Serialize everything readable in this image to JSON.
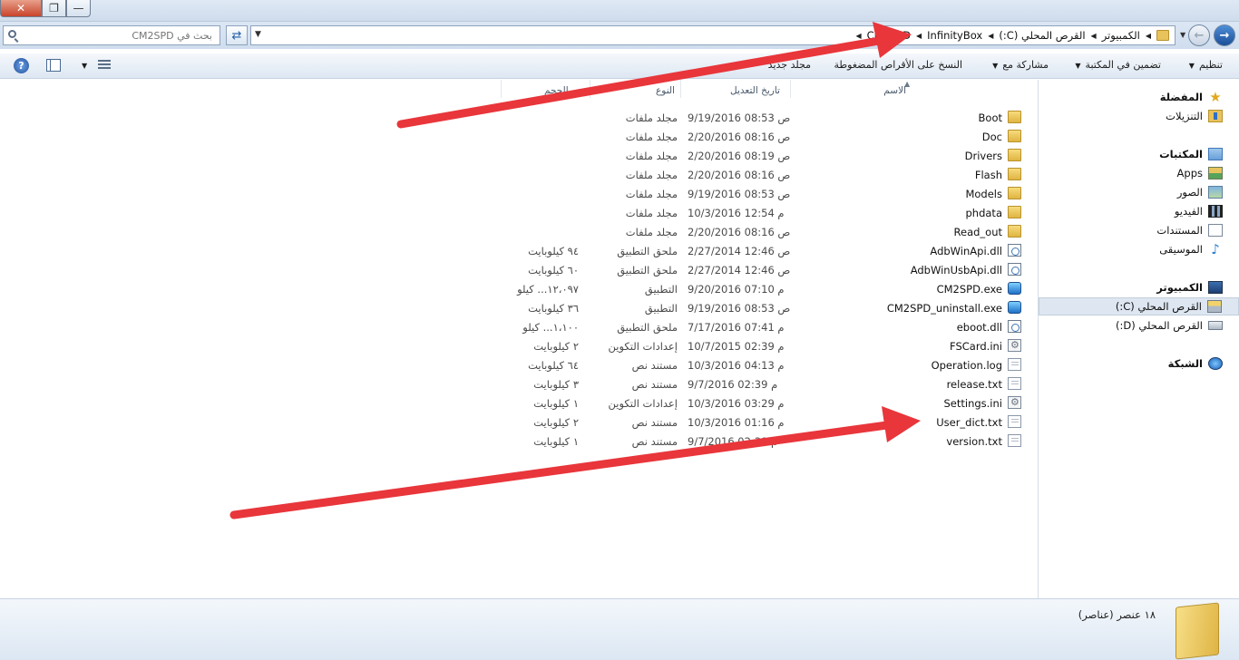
{
  "window": {
    "close_glyph": "✕",
    "maximize_glyph": "❐",
    "minimize_glyph": "—"
  },
  "search": {
    "placeholder": "بحث في CM2SPD"
  },
  "breadcrumbs": [
    "الكمبيوتر",
    "القرص المحلي (C:)",
    "InfinityBox",
    "CM2SPD"
  ],
  "toolbar": {
    "organize": "تنظيم",
    "include_in_library": "تضمين في المكتبة",
    "share_with": "مشاركة مع",
    "burn": "النسخ على الأقراص المضغوطة",
    "new_folder": "مجلد جديد",
    "help_glyph": "?"
  },
  "nav": {
    "favorites": "المفضلة",
    "downloads": "التنزيلات",
    "libraries": "المكتبات",
    "apps": "Apps",
    "pictures": "الصور",
    "videos": "الفيديو",
    "documents": "المستندات",
    "music": "الموسيقى",
    "computer": "الكمبيوتر",
    "drive_c": "القرص المحلي (C:)",
    "drive_d": "القرص المحلي (D:)",
    "network": "الشبكة"
  },
  "columns": {
    "name": "الاسم",
    "date": "تاريخ التعديل",
    "type": "النوع",
    "size": "الحجم"
  },
  "files": [
    {
      "name": "Boot",
      "date": "9/19/2016 08:53 ص",
      "type": "مجلد ملفات",
      "size": "",
      "icon": "folder"
    },
    {
      "name": "Doc",
      "date": "2/20/2016 08:16 ص",
      "type": "مجلد ملفات",
      "size": "",
      "icon": "folder"
    },
    {
      "name": "Drivers",
      "date": "2/20/2016 08:19 ص",
      "type": "مجلد ملفات",
      "size": "",
      "icon": "folder"
    },
    {
      "name": "Flash",
      "date": "2/20/2016 08:16 ص",
      "type": "مجلد ملفات",
      "size": "",
      "icon": "folder"
    },
    {
      "name": "Models",
      "date": "9/19/2016 08:53 ص",
      "type": "مجلد ملفات",
      "size": "",
      "icon": "folder"
    },
    {
      "name": "phdata",
      "date": "10/3/2016 12:54 م",
      "type": "مجلد ملفات",
      "size": "",
      "icon": "folder"
    },
    {
      "name": "Read_out",
      "date": "2/20/2016 08:16 ص",
      "type": "مجلد ملفات",
      "size": "",
      "icon": "folder"
    },
    {
      "name": "AdbWinApi.dll",
      "date": "2/27/2014 12:46 ص",
      "type": "ملحق التطبيق",
      "size": "٩٤ كيلوبايت",
      "icon": "dll"
    },
    {
      "name": "AdbWinUsbApi.dll",
      "date": "2/27/2014 12:46 ص",
      "type": "ملحق التطبيق",
      "size": "٦٠ كيلوبايت",
      "icon": "dll"
    },
    {
      "name": "CM2SPD.exe",
      "date": "9/20/2016 07:10 م",
      "type": "التطبيق",
      "size": "١٢،٠٩٧... كيلو",
      "icon": "exe"
    },
    {
      "name": "CM2SPD_uninstall.exe",
      "date": "9/19/2016 08:53 ص",
      "type": "التطبيق",
      "size": "٣٦ كيلوبايت",
      "icon": "exe"
    },
    {
      "name": "eboot.dll",
      "date": "7/17/2016 07:41 م",
      "type": "ملحق التطبيق",
      "size": "١،١٠٠... كيلو",
      "icon": "dll"
    },
    {
      "name": "FSCard.ini",
      "date": "10/7/2015 02:39 م",
      "type": "إعدادات التكوين",
      "size": "٢ كيلوبايت",
      "icon": "ini"
    },
    {
      "name": "Operation.log",
      "date": "10/3/2016 04:13 م",
      "type": "مستند نص",
      "size": "٦٤ كيلوبايت",
      "icon": "txt"
    },
    {
      "name": "release.txt",
      "date": "9/7/2016 02:39 م",
      "type": "مستند نص",
      "size": "٣ كيلوبايت",
      "icon": "txt"
    },
    {
      "name": "Settings.ini",
      "date": "10/3/2016 03:29 م",
      "type": "إعدادات التكوين",
      "size": "١ كيلوبايت",
      "icon": "ini"
    },
    {
      "name": "User_dict.txt",
      "date": "10/3/2016 01:16 م",
      "type": "مستند نص",
      "size": "٢ كيلوبايت",
      "icon": "txt"
    },
    {
      "name": "version.txt",
      "date": "9/7/2016 02:39 م",
      "type": "مستند نص",
      "size": "١ كيلوبايت",
      "icon": "txt"
    }
  ],
  "status": {
    "item_count": "١٨ عنصر (عناصر)"
  },
  "colors": {
    "annotation_arrow": "#e8363b",
    "selection": "#dde6f1"
  }
}
